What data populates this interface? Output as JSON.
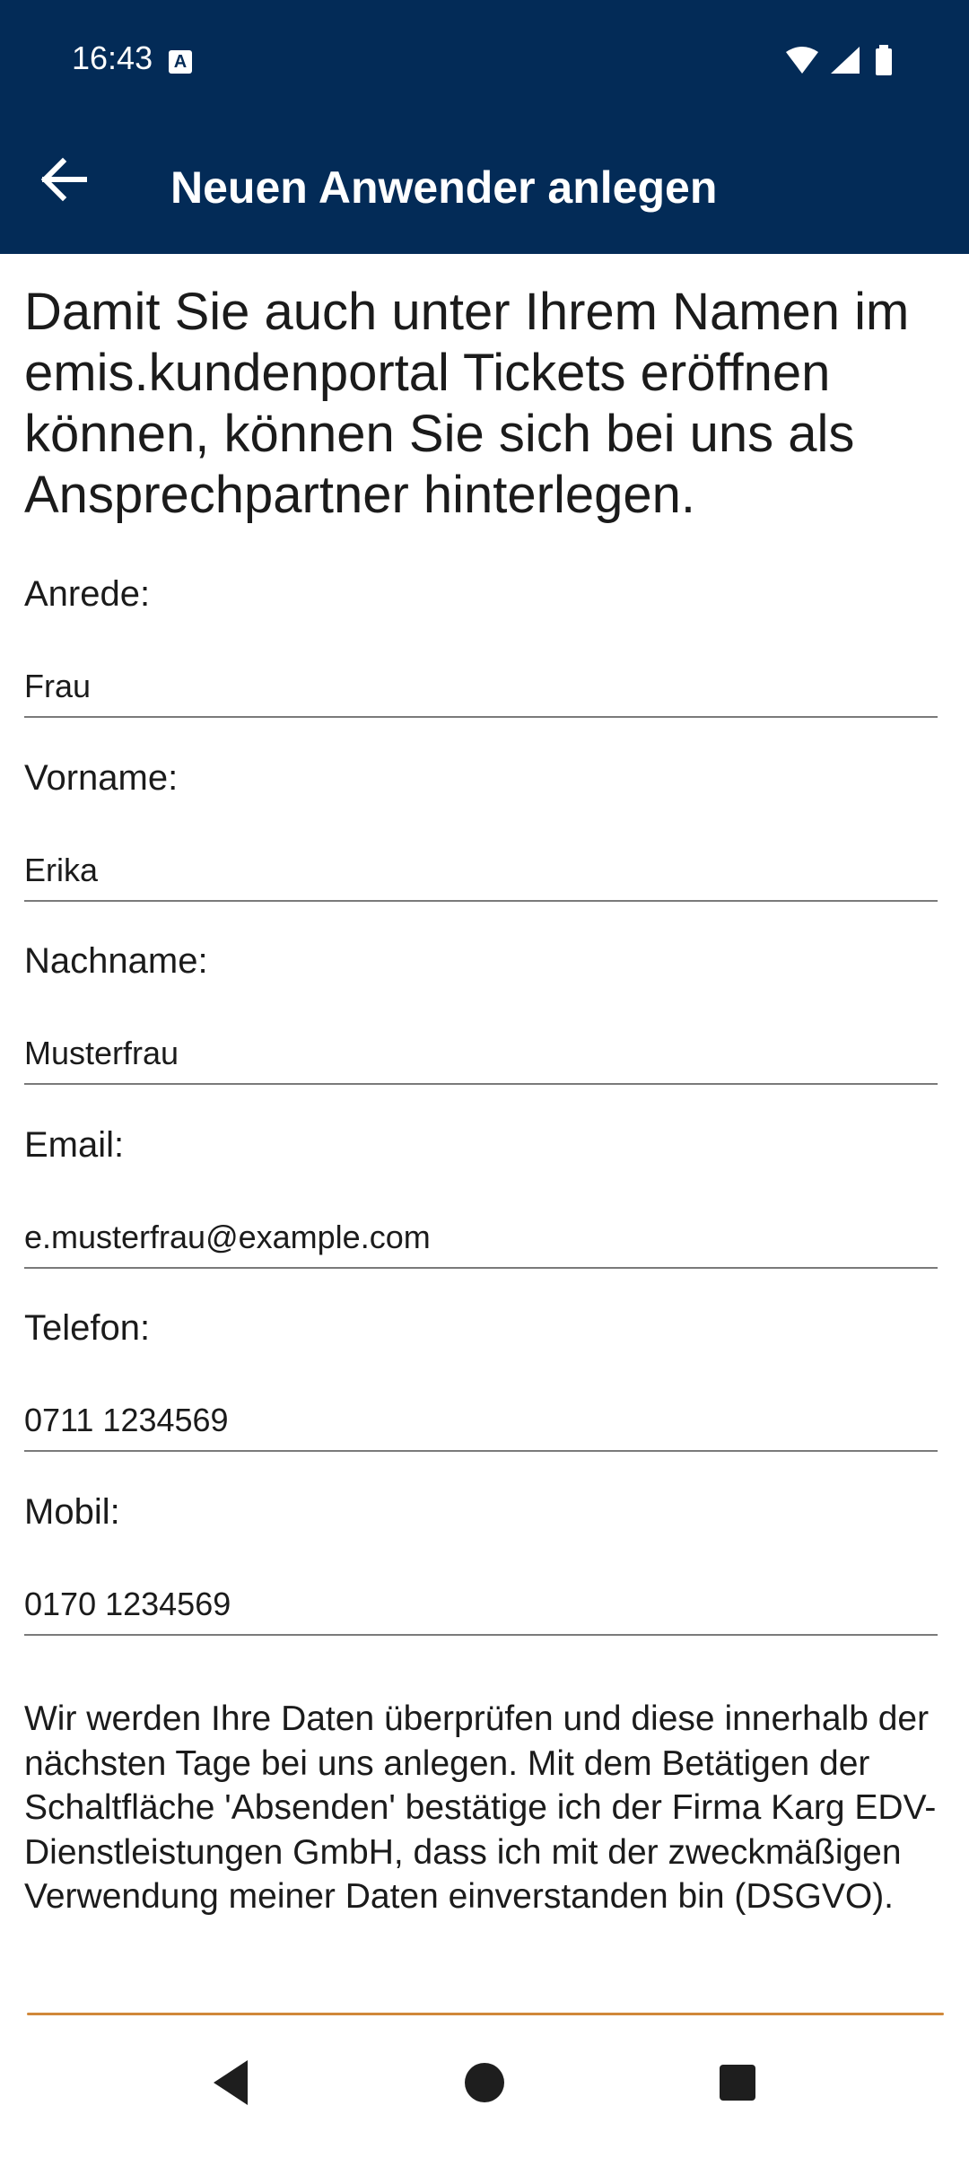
{
  "status_bar": {
    "time": "16:43",
    "notification_icon": "a-icon",
    "icons": [
      "wifi-icon",
      "signal-icon",
      "battery-icon"
    ]
  },
  "app_bar": {
    "title": "Neuen Anwender anlegen",
    "back_icon": "arrow-back-icon"
  },
  "intro": "Damit Sie auch unter Ihrem Namen im emis.kundenportal Tickets eröffnen können, können Sie sich bei uns als Ansprechpartner hinterlegen.",
  "form": {
    "fields": [
      {
        "label": "Anrede:",
        "value": "Frau"
      },
      {
        "label": "Vorname:",
        "value": "Erika"
      },
      {
        "label": "Nachname:",
        "value": "Musterfrau"
      },
      {
        "label": "Email:",
        "value": "e.musterfrau@example.com"
      },
      {
        "label": "Telefon:",
        "value": "0711 1234569"
      },
      {
        "label": "Mobil:",
        "value": "0170 1234569"
      }
    ]
  },
  "privacy_text": "Wir werden Ihre Daten überprüfen und diese innerhalb der nächsten Tage bei uns anlegen. Mit dem Betätigen der Schaltfläche 'Absenden' bestätige ich der Firma Karg EDV-Dienstleistungen GmbH, dass ich mit der zweckmäßigen Verwendung meiner Daten einverstanden bin (DSGVO).",
  "nav_bar": {
    "icons": [
      "nav-back-icon",
      "nav-home-icon",
      "nav-recents-icon"
    ]
  },
  "colors": {
    "app_bar": "#032b57",
    "accent_edge": "#d0883a",
    "field_line": "#7a7a7a"
  }
}
